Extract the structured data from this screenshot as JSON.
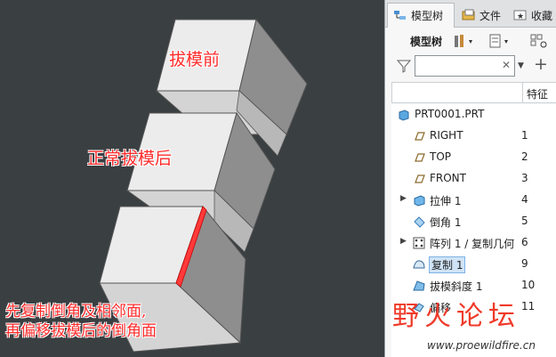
{
  "viewport": {
    "annotation_before": "拔模前",
    "annotation_after": "正常拔模后",
    "annotation_note_lines": [
      "先复制倒角及相邻面,",
      "再偏移拔模后的倒角面"
    ]
  },
  "panel": {
    "tabs": [
      {
        "label": "模型树",
        "icon": "model-tree-icon"
      },
      {
        "label": "文件",
        "icon": "folder-icon"
      },
      {
        "label": "收藏",
        "icon": "favorites-icon"
      }
    ],
    "toolbar": {
      "label": "模型树"
    },
    "search": {
      "value": ""
    },
    "column_header": "特征",
    "tree": [
      {
        "label": "PRT0001.PRT",
        "num": "",
        "icon": "part-icon",
        "expand": false
      },
      {
        "label": "RIGHT",
        "num": "1",
        "icon": "datum-plane-icon",
        "expand": false
      },
      {
        "label": "TOP",
        "num": "2",
        "icon": "datum-plane-icon",
        "expand": false
      },
      {
        "label": "FRONT",
        "num": "3",
        "icon": "datum-plane-icon",
        "expand": false
      },
      {
        "label": "拉伸 1",
        "num": "4",
        "icon": "extrude-icon",
        "expand": true
      },
      {
        "label": "倒角 1",
        "num": "5",
        "icon": "chamfer-icon",
        "expand": false
      },
      {
        "label": "阵列 1 / 复制几何",
        "num": "6",
        "icon": "pattern-icon",
        "expand": true
      },
      {
        "label": "复制 1",
        "num": "9",
        "icon": "copy-surface-icon",
        "expand": false,
        "selected": true
      },
      {
        "label": "拔模斜度 1",
        "num": "10",
        "icon": "draft-icon",
        "expand": false
      },
      {
        "label": "偏移",
        "num": "11",
        "icon": "offset-icon",
        "expand": false
      }
    ]
  },
  "watermark": {
    "title": "野火论坛",
    "url": "www.proewildfire.cn"
  },
  "colors": {
    "viewport_bg": "#3a3f42",
    "accent_red": "#ff2b2b",
    "selection": "#cfe3f6"
  }
}
